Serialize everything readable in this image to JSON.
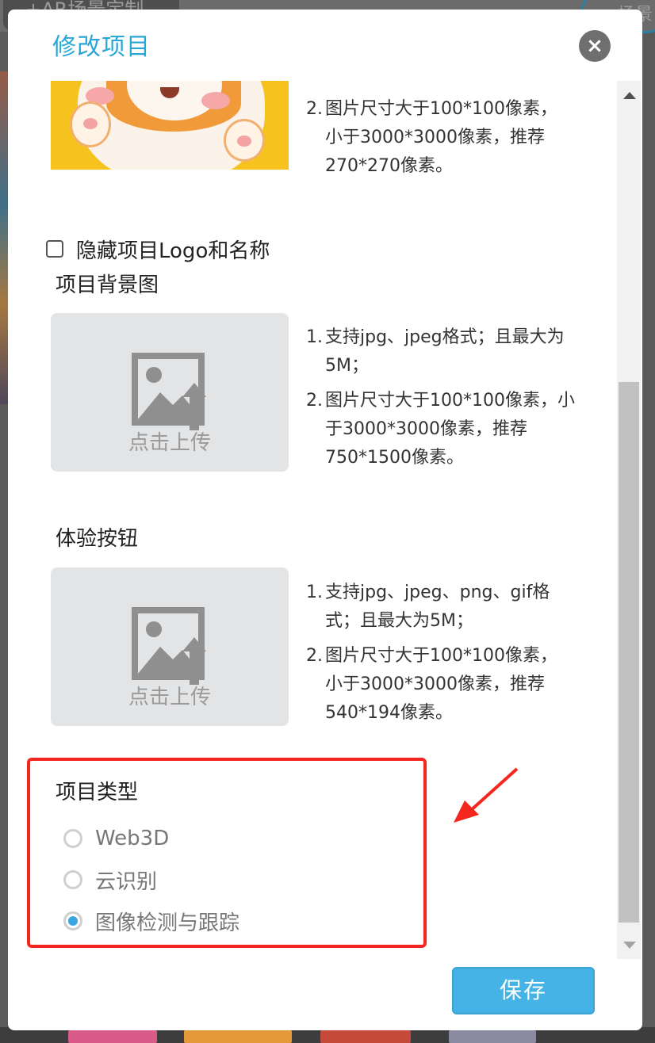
{
  "background": {
    "top_left_button": "+AR场景定制",
    "top_right_button": "场景"
  },
  "dialog": {
    "title": "修改项目",
    "close_glyph": "×",
    "scrollbar": {
      "up_icon": "triangle-up",
      "down_icon": "triangle-down"
    }
  },
  "logo_section": {
    "notes": [
      {
        "num": "2.",
        "text": "图片尺寸大于100*100像素，小于3000*3000像素，推荐270*270像素。"
      }
    ]
  },
  "hide_logo": {
    "label": "隐藏项目Logo和名称",
    "checked": false
  },
  "background_image": {
    "label": "项目背景图",
    "upload_text": "点击上传",
    "notes": [
      {
        "num": "1.",
        "text": "支持jpg、jpeg格式；且最大为5M；"
      },
      {
        "num": "2.",
        "text": "图片尺寸大于100*100像素，小于3000*3000像素，推荐750*1500像素。"
      }
    ]
  },
  "experience_button": {
    "label": "体验按钮",
    "upload_text": "点击上传",
    "notes": [
      {
        "num": "1.",
        "text": "支持jpg、jpeg、png、gif格式；且最大为5M；"
      },
      {
        "num": "2.",
        "text": "图片尺寸大于100*100像素，小于3000*3000像素，推荐540*194像素。"
      }
    ]
  },
  "project_type": {
    "label": "项目类型",
    "options": [
      {
        "label": "Web3D",
        "checked": false
      },
      {
        "label": "云识别",
        "checked": false
      },
      {
        "label": "图像检测与跟踪",
        "checked": true
      }
    ],
    "highlight_color": "#f5261e"
  },
  "save_label": "保存",
  "colors": {
    "accent": "#29a7d6",
    "button": "#45b3e5",
    "radio_checked": "#39a6e2"
  }
}
